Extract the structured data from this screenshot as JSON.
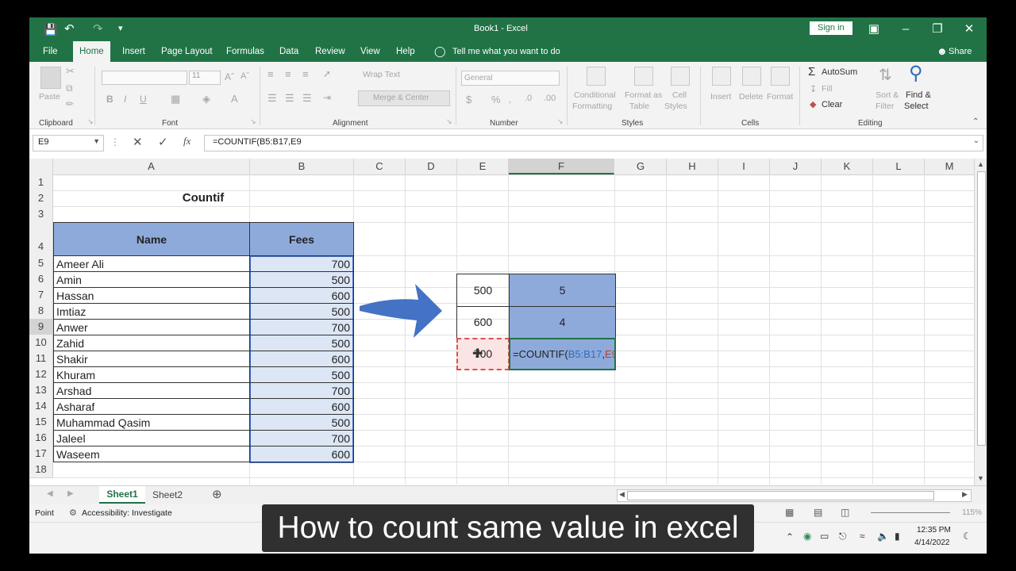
{
  "window": {
    "title": "Book1 - Excel",
    "sign_in": "Sign in",
    "share": "Share"
  },
  "tabs": [
    "File",
    "Home",
    "Insert",
    "Page Layout",
    "Formulas",
    "Data",
    "Review",
    "View",
    "Help"
  ],
  "tell_me": "Tell me what you want to do",
  "ribbon": {
    "clipboard": {
      "paste": "Paste",
      "group": "Clipboard"
    },
    "font": {
      "size": "11",
      "group": "Font",
      "bold": "B",
      "italic": "I",
      "underline": "U"
    },
    "alignment": {
      "wrap": "Wrap Text",
      "merge": "Merge & Center",
      "group": "Alignment"
    },
    "number": {
      "format": "General",
      "group": "Number",
      "currency": "$",
      "percent": "%"
    },
    "styles": {
      "cond1": "Conditional",
      "cond2": "Formatting",
      "fmt1": "Format as",
      "fmt2": "Table",
      "cell1": "Cell",
      "cell2": "Styles",
      "group": "Styles"
    },
    "cells": {
      "insert": "Insert",
      "delete": "Delete",
      "format": "Format",
      "group": "Cells"
    },
    "editing": {
      "autosum": "AutoSum",
      "fill": "Fill",
      "clear": "Clear",
      "sort1": "Sort &",
      "sort2": "Filter",
      "find1": "Find &",
      "find2": "Select",
      "group": "Editing"
    }
  },
  "formula_bar": {
    "name_box": "E9",
    "formula": "=COUNTIF(B5:B17,E9"
  },
  "columns": [
    "A",
    "B",
    "C",
    "D",
    "E",
    "F",
    "G",
    "H",
    "I",
    "J",
    "K",
    "L",
    "M"
  ],
  "rows": [
    "1",
    "2",
    "3",
    "4",
    "5",
    "6",
    "7",
    "8",
    "9",
    "10",
    "11",
    "12",
    "13",
    "14",
    "15",
    "16",
    "17",
    "18"
  ],
  "sheet": {
    "title": "Countif",
    "header_name": "Name",
    "header_fees": "Fees",
    "data": [
      {
        "name": "Ameer Ali",
        "fee": "700"
      },
      {
        "name": "Amin",
        "fee": "500"
      },
      {
        "name": "Hassan",
        "fee": "600"
      },
      {
        "name": "Imtiaz",
        "fee": "500"
      },
      {
        "name": "Anwer",
        "fee": "700"
      },
      {
        "name": "Zahid",
        "fee": "500"
      },
      {
        "name": "Shakir",
        "fee": "600"
      },
      {
        "name": "Khuram",
        "fee": "500"
      },
      {
        "name": "Arshad",
        "fee": "700"
      },
      {
        "name": "Asharaf",
        "fee": "600"
      },
      {
        "name": "Muhammad Qasim",
        "fee": "500"
      },
      {
        "name": "Jaleel",
        "fee": "700"
      },
      {
        "name": "Waseem",
        "fee": "600"
      }
    ],
    "lookup": [
      {
        "value": "500",
        "count": "5"
      },
      {
        "value": "600",
        "count": "4"
      }
    ],
    "edit_value": "700",
    "edit_formula_prefix": "=COUNTIF(",
    "edit_formula_range": "B5:B17",
    "edit_formula_comma": ",",
    "edit_formula_ref": "E9"
  },
  "sheet_tabs": [
    "Sheet1",
    "Sheet2"
  ],
  "status": {
    "mode": "Point",
    "accessibility": "Accessibility: Investigate",
    "zoom": "115%"
  },
  "taskbar": {
    "time": "12:35 PM",
    "date": "4/14/2022"
  },
  "caption": "How to count same value in excel",
  "colors": {
    "excel_green": "#217346",
    "header_blue": "#8eaadb",
    "selection_blue": "#dce6f4"
  }
}
